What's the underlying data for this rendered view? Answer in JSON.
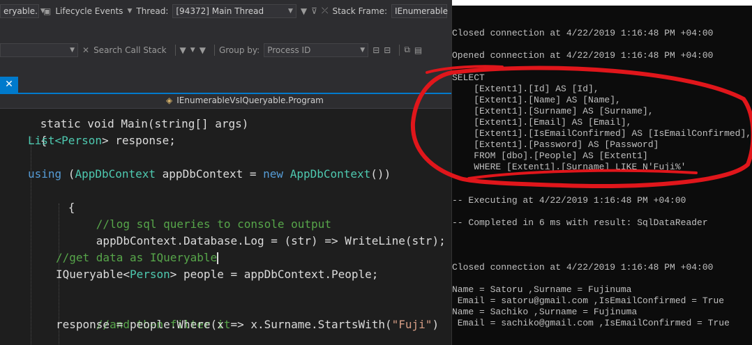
{
  "toolbar1": {
    "config_fragment": "eryable.",
    "lifecycle_label": "Lifecycle Events",
    "thread_label": "Thread:",
    "thread_value": "[94372] Main Thread",
    "stackframe_label": "Stack Frame:",
    "stackframe_value": "IEnumerable"
  },
  "toolbar2": {
    "search_label": "Search Call Stack",
    "groupby_label": "Group by:",
    "groupby_value": "Process ID"
  },
  "navbar": {
    "class_name": "IEnumerableVsIQueryable.Program"
  },
  "code": {
    "l0": "static void Main(string[] args)",
    "l1": "{",
    "l2_type": "List<",
    "l2_type2": "Person",
    "l2_rest": "> response;",
    "l4_using": "using",
    "l4_a": " (",
    "l4_ctx": "AppDbContext",
    "l4_b": " appDbContext = ",
    "l4_new": "new",
    "l4_c": " ",
    "l4_ctx2": "AppDbContext",
    "l4_d": "())",
    "l5": "{",
    "l6": "//log sql queries to console output",
    "l7": "appDbContext.Database.Log = (str) => WriteLine(str);",
    "l9": "//get data as IQueryable",
    "l10_a": "IQueryable<",
    "l10_type": "Person",
    "l10_b": "> people = appDbContext.People;",
    "l12": "//and then filter it",
    "l13_a": "response = people.Where(x => x.Surname.StartsWith(",
    "l13_str": "\"Fuji\"",
    "l13_b": ")"
  },
  "console": {
    "lines": [
      "Closed connection at 4/22/2019 1:16:48 PM +04:00",
      "",
      "Opened connection at 4/22/2019 1:16:48 PM +04:00",
      "",
      "SELECT",
      "    [Extent1].[Id] AS [Id],",
      "    [Extent1].[Name] AS [Name],",
      "    [Extent1].[Surname] AS [Surname],",
      "    [Extent1].[Email] AS [Email],",
      "    [Extent1].[IsEmailConfirmed] AS [IsEmailConfirmed],",
      "    [Extent1].[Password] AS [Password]",
      "    FROM [dbo].[People] AS [Extent1]",
      "    WHERE [Extent1].[Surname] LIKE N'Fuji%'",
      "",
      "",
      "-- Executing at 4/22/2019 1:16:48 PM +04:00",
      "",
      "-- Completed in 6 ms with result: SqlDataReader",
      "",
      "",
      "",
      "Closed connection at 4/22/2019 1:16:48 PM +04:00",
      "",
      "Name = Satoru ,Surname = Fujinuma",
      " Email = satoru@gmail.com ,IsEmailConfirmed = True",
      "Name = Sachiko ,Surname = Fujinuma",
      " Email = sachiko@gmail.com ,IsEmailConfirmed = True"
    ]
  },
  "colors": {
    "annotation": "#e0161b",
    "accent": "#007acc"
  }
}
